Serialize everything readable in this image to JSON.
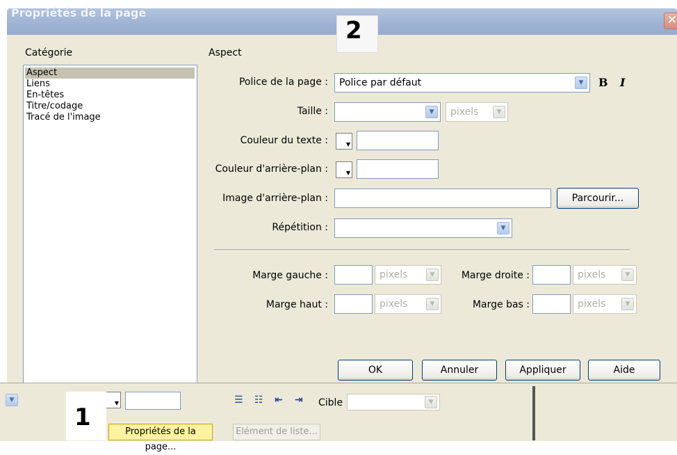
{
  "dialog": {
    "title": "Propriétés de la page",
    "close_icon": "close-icon",
    "step_label": "2"
  },
  "categories": {
    "heading": "Catégorie",
    "items": [
      {
        "label": "Aspect",
        "selected": true
      },
      {
        "label": "Liens",
        "selected": false
      },
      {
        "label": "En-têtes",
        "selected": false
      },
      {
        "label": "Titre/codage",
        "selected": false
      },
      {
        "label": "Tracé de l'image",
        "selected": false
      }
    ]
  },
  "aspect": {
    "heading": "Aspect",
    "font_label": "Police de la page :",
    "font_value": "Police par défaut",
    "bold_label": "B",
    "italic_label": "I",
    "size_label": "Taille :",
    "size_value": "",
    "size_unit": "pixels",
    "text_color_label": "Couleur du texte :",
    "text_color_value": "",
    "bg_color_label": "Couleur d'arrière-plan :",
    "bg_color_value": "",
    "bg_image_label": "Image d'arrière-plan :",
    "bg_image_value": "",
    "browse_label": "Parcourir...",
    "repeat_label": "Répétition :",
    "repeat_value": "",
    "margin_left_label": "Marge gauche :",
    "margin_right_label": "Marge droite :",
    "margin_top_label": "Marge haut :",
    "margin_bottom_label": "Marge bas :",
    "margin_unit": "pixels"
  },
  "buttons": {
    "ok": "OK",
    "cancel": "Annuler",
    "apply": "Appliquer",
    "help": "Aide"
  },
  "inspector": {
    "step_label": "1",
    "target_label": "Cible",
    "page_props_button": "Propriétés de la page...",
    "list_item_button": "Elément de liste..."
  },
  "colors": {
    "titlebar": "#9eb2d3",
    "dialog_bg": "#ece9d8",
    "highlight": "#fff3a1"
  }
}
